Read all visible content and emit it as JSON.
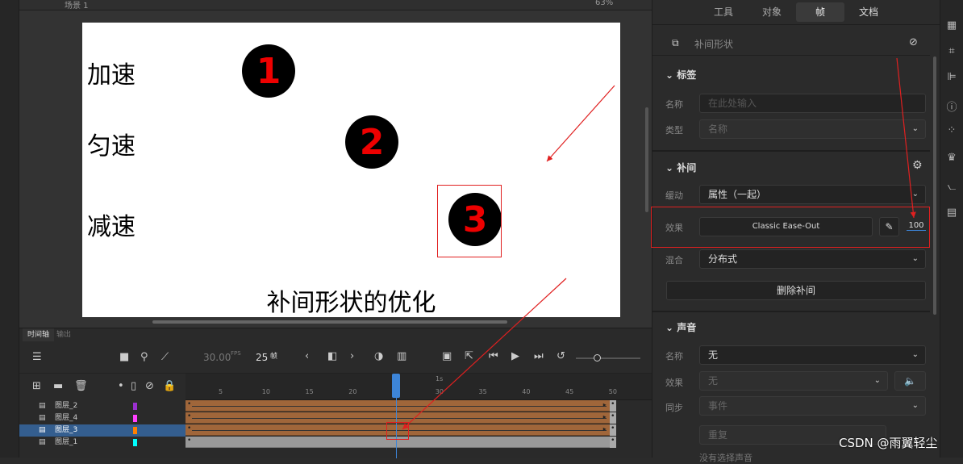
{
  "stage": {
    "scene": "场景 1",
    "zoom": "63%"
  },
  "canvas": {
    "labels": [
      "加速",
      "匀速",
      "减速"
    ],
    "numbers": [
      "1",
      "2",
      "3"
    ],
    "caption": "补间形状的优化"
  },
  "timeline": {
    "tabs": [
      "时间轴",
      "输出"
    ],
    "fps": "30.00",
    "fps_unit": "FPS",
    "frame": "25",
    "frame_unit": "帧",
    "ruler": [
      "5",
      "10",
      "15",
      "20",
      "25",
      "30",
      "35",
      "40",
      "45",
      "50"
    ],
    "ruler_time": "1s",
    "current_frame": 25,
    "total_frames": 50,
    "layers": [
      {
        "name": "图层_2",
        "color": "#9b30d0",
        "tween": true
      },
      {
        "name": "图层_4",
        "color": "#ff40ff",
        "tween": true
      },
      {
        "name": "图层_3",
        "color": "#ff8000",
        "tween": true,
        "selected": true
      },
      {
        "name": "图层_1",
        "color": "#00ffff",
        "tween": false
      }
    ]
  },
  "panel": {
    "tabs": [
      "工具",
      "对象",
      "帧",
      "文档"
    ],
    "active_tab": "帧",
    "header": "补间形状",
    "label_section": {
      "title": "标签",
      "name_label": "名称",
      "name_placeholder": "在此处输入",
      "type_label": "类型",
      "type_value": "名称"
    },
    "tween_section": {
      "title": "补间",
      "ease_label": "缓动",
      "ease_value": "属性（一起）",
      "effect_label": "效果",
      "effect_value": "Classic Ease-Out",
      "effect_amount": "100",
      "blend_label": "混合",
      "blend_value": "分布式",
      "delete_button": "删除补间"
    },
    "sound_section": {
      "title": "声音",
      "name_label": "名称",
      "name_value": "无",
      "effect_label": "效果",
      "effect_value": "无",
      "sync_label": "同步",
      "sync_value": "事件",
      "repeat_value": "重复",
      "no_sound": "没有选择声音"
    }
  },
  "watermark": "CSDN @雨翼轻尘",
  "annotation_color": "#e02020"
}
